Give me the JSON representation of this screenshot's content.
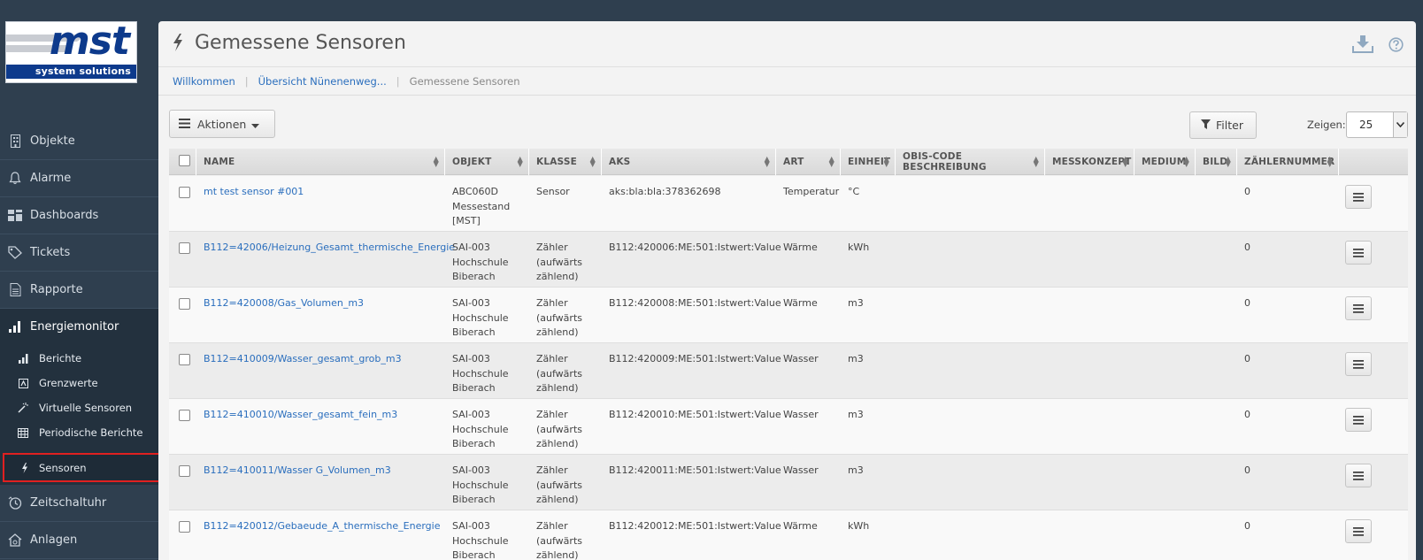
{
  "logo": {
    "brand": "mst",
    "tagline": "system solutions"
  },
  "sidebar": {
    "items": [
      {
        "label": "Objekte",
        "icon": "building-icon"
      },
      {
        "label": "Alarme",
        "icon": "bell-icon"
      },
      {
        "label": "Dashboards",
        "icon": "dashboard-icon"
      },
      {
        "label": "Tickets",
        "icon": "ticket-icon"
      },
      {
        "label": "Rapporte",
        "icon": "document-icon"
      },
      {
        "label": "Energiemonitor",
        "icon": "bar-chart-icon"
      },
      {
        "label": "Zeitschaltuhr",
        "icon": "clock-icon"
      },
      {
        "label": "Anlagen",
        "icon": "home-gear-icon"
      }
    ],
    "sub_items": [
      {
        "label": "Berichte",
        "icon": "bar-chart-icon"
      },
      {
        "label": "Grenzwerte",
        "icon": "limit-icon"
      },
      {
        "label": "Virtuelle Sensoren",
        "icon": "magic-wand-icon"
      },
      {
        "label": "Periodische Berichte",
        "icon": "table-icon"
      },
      {
        "label": "Sensoren",
        "icon": "bolt-icon"
      }
    ]
  },
  "header": {
    "title": "Gemessene Sensoren"
  },
  "breadcrumb": {
    "items": [
      "Willkommen",
      "Übersicht Nünenenweg...",
      "Gemessene Sensoren"
    ]
  },
  "toolbar": {
    "aktionen_label": "Aktionen",
    "filter_label": "Filter",
    "zeigen_label": "Zeigen:",
    "zeigen_value": "25"
  },
  "table": {
    "columns": [
      "Name",
      "Objekt",
      "Klasse",
      "AKS",
      "Art",
      "Einheit",
      "OBIS-Code Beschreibung",
      "Messkonzept",
      "Medium",
      "Bild",
      "Zählernummer"
    ],
    "rows": [
      {
        "name": "mt test sensor #001",
        "objekt": [
          "ABC060D",
          "Messestand",
          "[MST]"
        ],
        "klasse": [
          "Sensor"
        ],
        "aks": "aks:bla:bla:378362698",
        "art": "Temperatur",
        "einheit": "°C",
        "zaehlernummer": "0"
      },
      {
        "name": "B112=42006/Heizung_Gesamt_thermische_Energie",
        "objekt": [
          "SAI-003",
          "Hochschule",
          "Biberach"
        ],
        "klasse": [
          "Zähler",
          "(aufwärts",
          "zählend)"
        ],
        "aks": "B112:420006:ME:501:Istwert:Value",
        "art": "Wärme",
        "einheit": "kWh",
        "zaehlernummer": "0"
      },
      {
        "name": "B112=420008/Gas_Volumen_m3",
        "objekt": [
          "SAI-003",
          "Hochschule",
          "Biberach"
        ],
        "klasse": [
          "Zähler",
          "(aufwärts",
          "zählend)"
        ],
        "aks": "B112:420008:ME:501:Istwert:Value",
        "art": "Wärme",
        "einheit": "m3",
        "zaehlernummer": "0"
      },
      {
        "name": "B112=410009/Wasser_gesamt_grob_m3",
        "objekt": [
          "SAI-003",
          "Hochschule",
          "Biberach"
        ],
        "klasse": [
          "Zähler",
          "(aufwärts",
          "zählend)"
        ],
        "aks": "B112:420009:ME:501:Istwert:Value",
        "art": "Wasser",
        "einheit": "m3",
        "zaehlernummer": "0"
      },
      {
        "name": "B112=410010/Wasser_gesamt_fein_m3",
        "objekt": [
          "SAI-003",
          "Hochschule",
          "Biberach"
        ],
        "klasse": [
          "Zähler",
          "(aufwärts",
          "zählend)"
        ],
        "aks": "B112:420010:ME:501:Istwert:Value",
        "art": "Wasser",
        "einheit": "m3",
        "zaehlernummer": "0"
      },
      {
        "name": "B112=410011/Wasser G_Volumen_m3",
        "objekt": [
          "SAI-003",
          "Hochschule",
          "Biberach"
        ],
        "klasse": [
          "Zähler",
          "(aufwärts",
          "zählend)"
        ],
        "aks": "B112:420011:ME:501:Istwert:Value",
        "art": "Wasser",
        "einheit": "m3",
        "zaehlernummer": "0"
      },
      {
        "name": "B112=420012/Gebaeude_A_thermische_Energie",
        "objekt": [
          "SAI-003",
          "Hochschule",
          "Biberach"
        ],
        "klasse": [
          "Zähler",
          "(aufwärts",
          "zählend)"
        ],
        "aks": "B112:420012:ME:501:Istwert:Value",
        "art": "Wärme",
        "einheit": "kWh",
        "zaehlernummer": "0"
      }
    ]
  },
  "colors": {
    "sidebar_bg": "#2f3f4f",
    "link": "#2a6ebd",
    "selected_outline": "#e02020",
    "brand_blue": "#0d3a8c"
  }
}
